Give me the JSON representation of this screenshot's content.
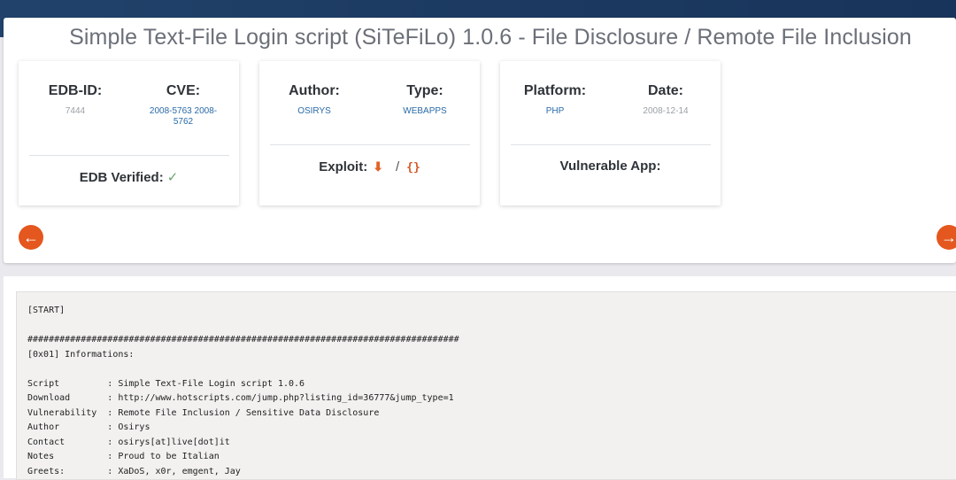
{
  "page": {
    "title": "Simple Text-File Login script (SiTeFiLo) 1.0.6 - File Disclosure / Remote File Inclusion"
  },
  "card1": {
    "edb_label": "EDB-ID:",
    "edb_value": "7444",
    "cve_label": "CVE:",
    "cve_value": "2008-5763 2008-5762",
    "verified_label": "EDB Verified:",
    "verified_icon": "check-icon"
  },
  "card2": {
    "author_label": "Author:",
    "author_value": "OSIRYS",
    "type_label": "Type:",
    "type_value": "WEBAPPS",
    "exploit_label": "Exploit:",
    "download_icon": "download-icon",
    "separator": "/",
    "code_icon_text": "{}"
  },
  "card3": {
    "platform_label": "Platform:",
    "platform_value": "PHP",
    "date_label": "Date:",
    "date_value": "2008-12-14",
    "vuln_label": "Vulnerable App:"
  },
  "nav": {
    "prev_icon": "arrow-left-icon",
    "next_icon": "arrow-right-icon"
  },
  "colors": {
    "accent": "#e4571e",
    "link": "#2a6aa8",
    "header": "#1c3a62"
  },
  "code": {
    "lines": [
      "[START]",
      "",
      "#################################################################################",
      "[0x01] Informations:",
      "",
      "Script         : Simple Text-File Login script 1.0.6",
      "Download       : http://www.hotscripts.com/jump.php?listing_id=36777&jump_type=1",
      "Vulnerability  : Remote File Inclusion / Sensitive Data Disclosure",
      "Author         : Osirys",
      "Contact        : osirys[at]live[dot]it",
      "Notes          : Proud to be Italian",
      "Greets:        : XaDoS, x0r, emgent, Jay"
    ]
  }
}
